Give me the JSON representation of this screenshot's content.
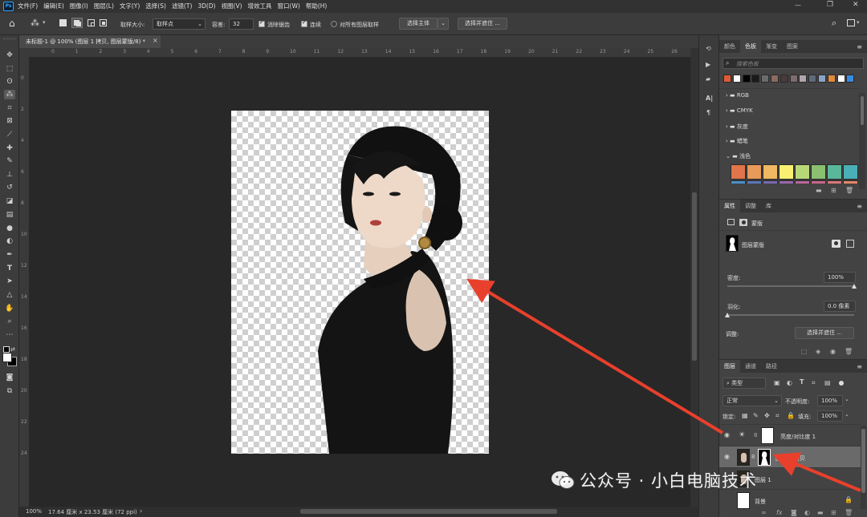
{
  "menu": [
    "文件(F)",
    "编辑(E)",
    "图像(I)",
    "图层(L)",
    "文字(Y)",
    "选择(S)",
    "滤镜(T)",
    "3D(D)",
    "视图(V)",
    "增效工具",
    "窗口(W)",
    "帮助(H)"
  ],
  "app_icon": "Ps",
  "window_controls": {
    "minimize": "—",
    "restore": "❐",
    "close": "✕"
  },
  "options_bar": {
    "sample_size_label": "取样大小:",
    "sample_size_value": "取样点",
    "tolerance_label": "容差:",
    "tolerance_value": "32",
    "antialias_label": "消除锯齿",
    "contiguous_label": "连续",
    "sample_all_label": "对所有图层取样",
    "select_subject_label": "选择主体",
    "select_and_mask_label": "选择并遮住 ..."
  },
  "document_tab": {
    "title": "未标题-1 @ 100% (图层 1 拷贝, 图层蒙版/8) *",
    "close": "×"
  },
  "ruler_top": [
    "0",
    "1",
    "2",
    "3",
    "4",
    "5",
    "6",
    "7",
    "8",
    "9",
    "10",
    "11",
    "12",
    "13",
    "14",
    "15",
    "16",
    "17",
    "18",
    "19",
    "20",
    "21",
    "22",
    "23",
    "24",
    "25",
    "26"
  ],
  "ruler_left": [
    "0",
    "2",
    "4",
    "6",
    "8",
    "10",
    "12",
    "14",
    "16",
    "18",
    "20",
    "22",
    "24"
  ],
  "status": {
    "zoom": "100%",
    "doc_info": "17.64 厘米 x 23.53 厘米 (72 ppi)",
    "arrow": "›"
  },
  "swatches_panel": {
    "tabs": [
      "颜色",
      "色板",
      "渐变",
      "图案"
    ],
    "active_tab": "色板",
    "search_placeholder": "搜索色板",
    "recent_colors": [
      "#e05a36",
      "#ffffff",
      "#000000",
      "#1a1a1a",
      "#6b6b6b",
      "#8a6b5e",
      "#4a3a3a",
      "#7d6b70",
      "#b0a6b0",
      "#5e6a7a",
      "#8aa3c8",
      "#e08a3a",
      "#ffffff",
      "#3a8ae0"
    ],
    "folders": [
      "RGB",
      "CMYK",
      "灰度",
      "蜡笔",
      "浅色"
    ],
    "pastel_colors": [
      "#e0744a",
      "#e89a5a",
      "#f0b860",
      "#f8f070",
      "#b8d878",
      "#8ac070",
      "#5ab89a",
      "#4ab0b8"
    ],
    "pastel_colors_row2": [
      "#4a90c8",
      "#5a78b8",
      "#7a68b0",
      "#9868a8",
      "#b86898",
      "#c8688a",
      "#d87878",
      "#e08868"
    ]
  },
  "properties_panel": {
    "tabs": [
      "属性",
      "调整",
      "库"
    ],
    "active_tab": "属性",
    "mask_heading": "蒙版",
    "layer_mask_label": "图层蒙版",
    "density_label": "密度:",
    "density_value": "100%",
    "density_fraction": 1.0,
    "feather_label": "羽化:",
    "feather_value": "0.0 像素",
    "feather_fraction": 0.0,
    "refine_label": "调整:",
    "select_and_mask_label": "选择并遮住 ..."
  },
  "layers_panel": {
    "tabs": [
      "图层",
      "通道",
      "路径"
    ],
    "active_tab": "图层",
    "filter_kind": "类型",
    "blend_mode": "正常",
    "opacity_label": "不透明度:",
    "opacity_value": "100%",
    "lock_label": "锁定:",
    "fill_label": "填充:",
    "fill_value": "100%",
    "layers": [
      {
        "name": "亮度/对比度 1",
        "visible": true,
        "selected": false
      },
      {
        "name": "图层 1 拷贝",
        "visible": true,
        "selected": true
      },
      {
        "name": "图层 1",
        "visible": false,
        "selected": false
      },
      {
        "name": "背景",
        "visible": false,
        "selected": false
      }
    ]
  },
  "watermark": {
    "text": "公众号 · 小白电脑技术"
  },
  "colors": {
    "arrow": "#e8402c",
    "canvas_bg": "#282828",
    "panel_bg": "#434343",
    "selected_layer": "#6a6a6a"
  }
}
